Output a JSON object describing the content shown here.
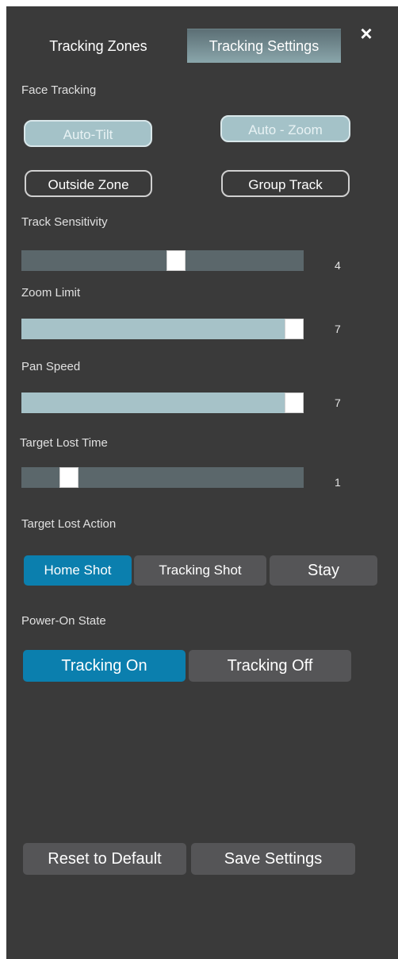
{
  "tabs": {
    "zones": "Tracking Zones",
    "settings": "Tracking Settings",
    "close": "×"
  },
  "face_tracking": {
    "label": "Face Tracking",
    "auto_tilt": "Auto-Tilt",
    "auto_zoom": "Auto - Zoom",
    "outside_zone": "Outside Zone",
    "group_track": "Group Track"
  },
  "sliders": {
    "track_sensitivity": {
      "label": "Track Sensitivity",
      "value": "4",
      "fraction": 0.55
    },
    "zoom_limit": {
      "label": "Zoom Limit",
      "value": "7",
      "fraction": 1.0
    },
    "pan_speed": {
      "label": "Pan Speed",
      "value": "7",
      "fraction": 1.0
    },
    "target_lost_time": {
      "label": "Target Lost Time",
      "value": "1",
      "fraction": 0.0
    }
  },
  "target_lost_action": {
    "label": "Target Lost Action",
    "options": [
      "Home Shot",
      "Tracking Shot",
      "Stay"
    ],
    "selected": "Home Shot"
  },
  "power_on_state": {
    "label": "Power-On State",
    "options": [
      "Tracking On",
      "Tracking Off"
    ],
    "selected": "Tracking On"
  },
  "footer": {
    "reset": "Reset to Default",
    "save": "Save Settings"
  },
  "colors": {
    "panel_bg": "#3a3a3a",
    "accent_blue": "#0b7fae",
    "slider_fill": "#a6c2c8",
    "slider_track": "#5b676b",
    "button_gray": "#555557"
  }
}
